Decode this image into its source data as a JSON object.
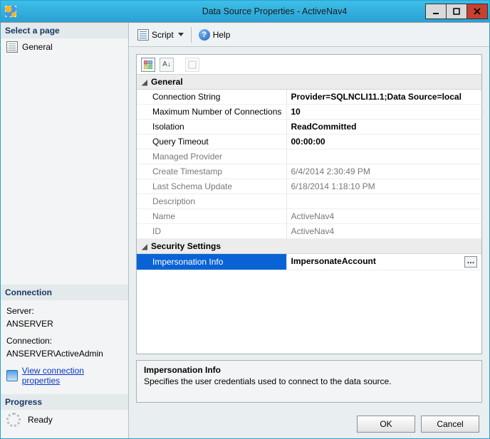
{
  "window": {
    "title": "Data Source Properties - ActiveNav4"
  },
  "sidebar": {
    "selectLabel": "Select a page",
    "pages": [
      {
        "label": "General"
      }
    ],
    "connection": {
      "heading": "Connection",
      "serverLabel": "Server:",
      "serverValue": "ANSERVER",
      "connLabel": "Connection:",
      "connValue": "ANSERVER\\ActiveAdmin",
      "viewLink": "View connection properties"
    },
    "progress": {
      "heading": "Progress",
      "status": "Ready"
    }
  },
  "toolbar": {
    "script": "Script",
    "help": "Help"
  },
  "grid": {
    "catGeneral": "General",
    "catSecurity": "Security Settings",
    "rows": {
      "connStr": {
        "label": "Connection String",
        "value": "Provider=SQLNCLI11.1;Data Source=local"
      },
      "maxConn": {
        "label": "Maximum Number of Connections",
        "value": "10"
      },
      "isolation": {
        "label": "Isolation",
        "value": "ReadCommitted"
      },
      "qtimeout": {
        "label": "Query Timeout",
        "value": "00:00:00"
      },
      "mprov": {
        "label": "Managed Provider",
        "value": ""
      },
      "cts": {
        "label": "Create Timestamp",
        "value": "6/4/2014 2:30:49 PM"
      },
      "lsu": {
        "label": "Last Schema Update",
        "value": "6/18/2014 1:18:10 PM"
      },
      "desc": {
        "label": "Description",
        "value": ""
      },
      "name": {
        "label": "Name",
        "value": "ActiveNav4"
      },
      "id": {
        "label": "ID",
        "value": "ActiveNav4"
      },
      "imp": {
        "label": "Impersonation Info",
        "value": "ImpersonateAccount"
      }
    }
  },
  "descPane": {
    "title": "Impersonation Info",
    "text": "Specifies the user credentials used to connect to the data source."
  },
  "buttons": {
    "ok": "OK",
    "cancel": "Cancel"
  }
}
